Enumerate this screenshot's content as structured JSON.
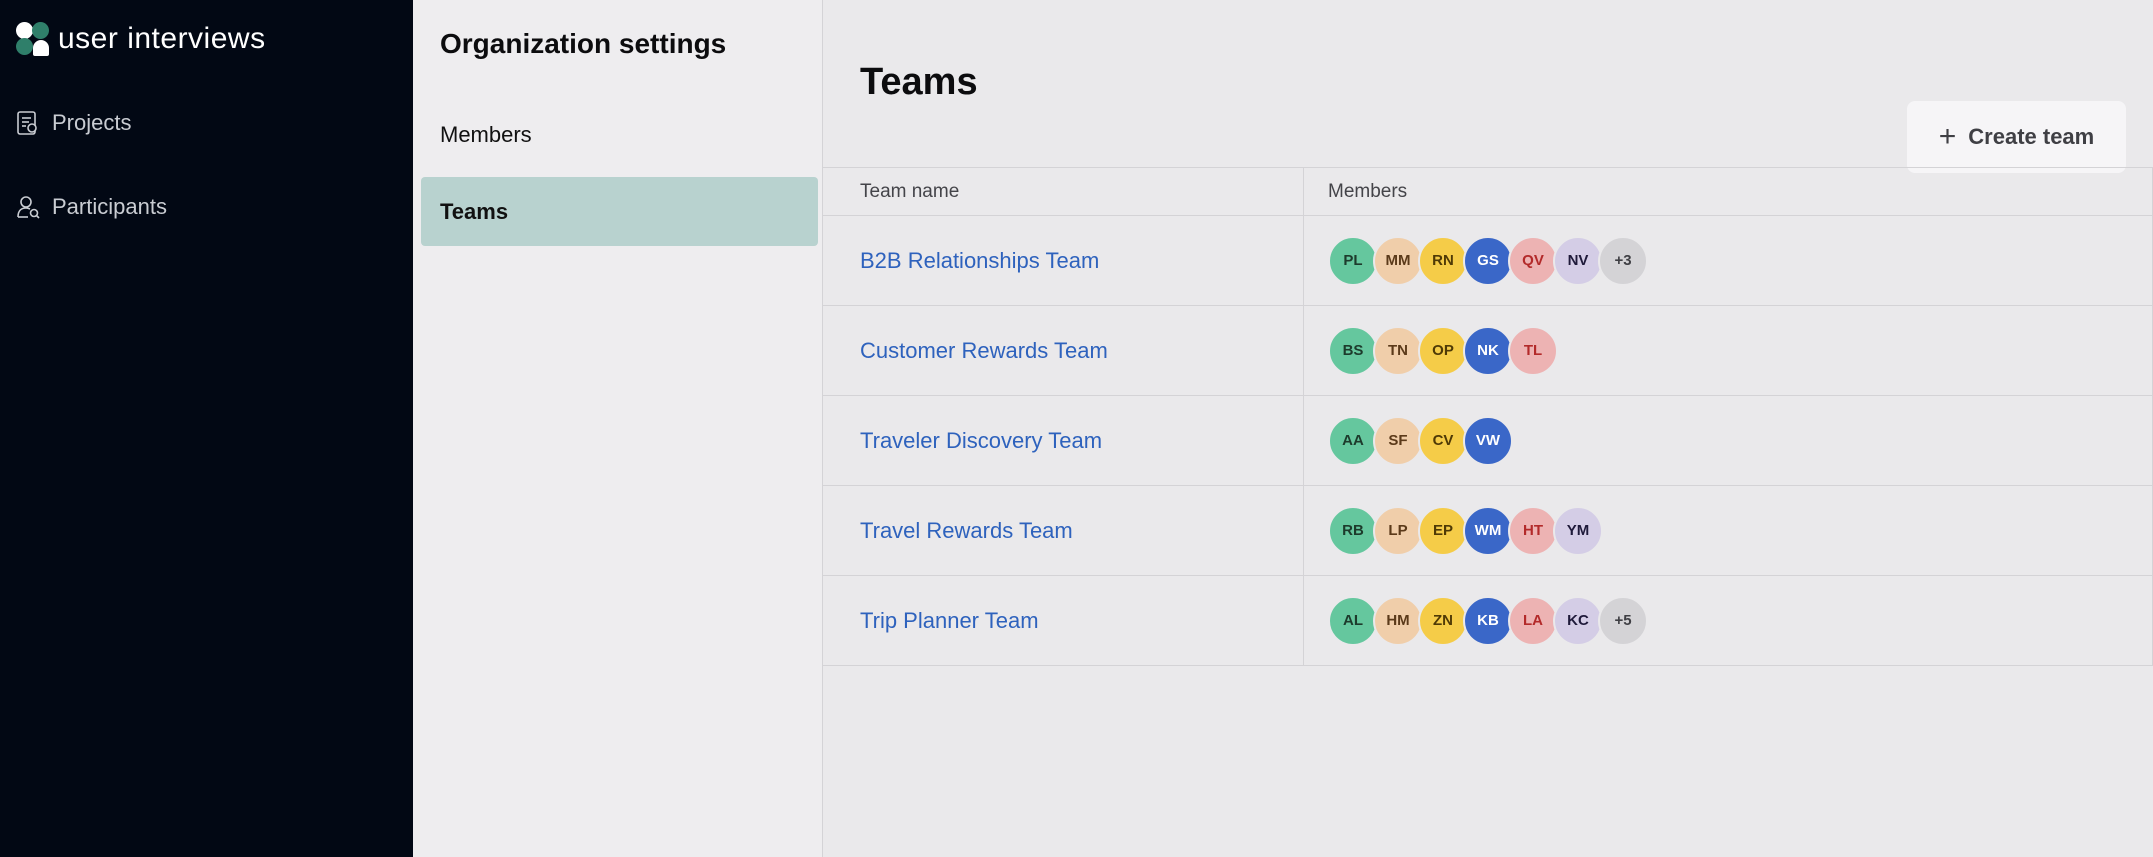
{
  "brand": {
    "name": "user interviews"
  },
  "nav": {
    "items": [
      {
        "label": "Projects",
        "icon": "document-icon"
      },
      {
        "label": "Participants",
        "icon": "user-search-icon"
      }
    ]
  },
  "settings": {
    "title": "Organization settings",
    "items": [
      {
        "label": "Members",
        "active": false
      },
      {
        "label": "Teams",
        "active": true
      }
    ]
  },
  "main": {
    "title": "Teams",
    "create_button": "Create team",
    "columns": {
      "name": "Team name",
      "members": "Members"
    },
    "teams": [
      {
        "name": "B2B Relationships Team",
        "members": [
          "PL",
          "MM",
          "RN",
          "GS",
          "QV",
          "NV"
        ],
        "more": "+3"
      },
      {
        "name": "Customer Rewards Team",
        "members": [
          "BS",
          "TN",
          "OP",
          "NK",
          "TL"
        ],
        "more": ""
      },
      {
        "name": "Traveler Discovery Team",
        "members": [
          "AA",
          "SF",
          "CV",
          "VW"
        ],
        "more": ""
      },
      {
        "name": "Travel Rewards Team",
        "members": [
          "RB",
          "LP",
          "EP",
          "WM",
          "HT",
          "YM"
        ],
        "more": ""
      },
      {
        "name": "Trip Planner Team",
        "members": [
          "AL",
          "HM",
          "ZN",
          "KB",
          "LA",
          "KC"
        ],
        "more": "+5"
      }
    ]
  },
  "colors": {
    "nav_bg": "#020814",
    "active_item_bg": "#b8d2cf",
    "link": "#2e62bd",
    "avatar_palette": [
      "#65c79e",
      "#f0ceaa",
      "#f5cc48",
      "#3a67c8",
      "#edb3b3",
      "#d4cde6"
    ]
  }
}
